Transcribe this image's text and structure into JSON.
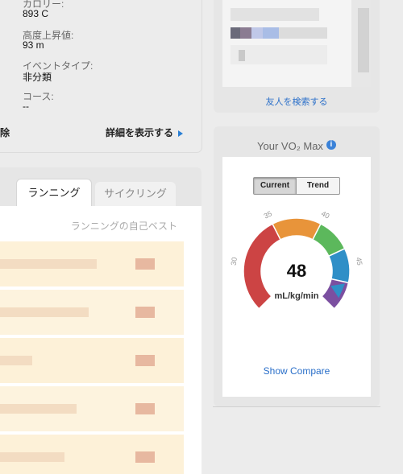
{
  "activity": {
    "calories_label": "カロリー:",
    "calories_value": "893 C",
    "elevation_label": "高度上昇値:",
    "elevation_value": "93 m",
    "event_type_label": "イベントタイプ:",
    "event_type_value": "非分類",
    "course_label": "コース:",
    "course_value": "--",
    "delete_label": "除",
    "details_label": "詳細を表示する"
  },
  "records": {
    "tabs": [
      {
        "label": "ランニング",
        "active": true
      },
      {
        "label": "サイクリング",
        "active": false
      }
    ],
    "title": "ランニングの自己ベスト"
  },
  "friends": {
    "find_label": "友人を検索する"
  },
  "vo2": {
    "title": "Your VO₂ Max",
    "info_icon": "i",
    "toggle": [
      {
        "label": "Current",
        "active": true
      },
      {
        "label": "Trend",
        "active": false
      }
    ],
    "value": "48",
    "unit": "mL/kg/min",
    "scale_ticks": [
      "25",
      "30",
      "35",
      "40",
      "45",
      "50"
    ],
    "segment_colors": [
      "#cc4444",
      "#e8943a",
      "#5cb85c",
      "#2f8fc7",
      "#7b4fa0"
    ],
    "pointer_value": 48,
    "scale_min": 25,
    "scale_max": 50,
    "compare_label": "Show Compare"
  }
}
